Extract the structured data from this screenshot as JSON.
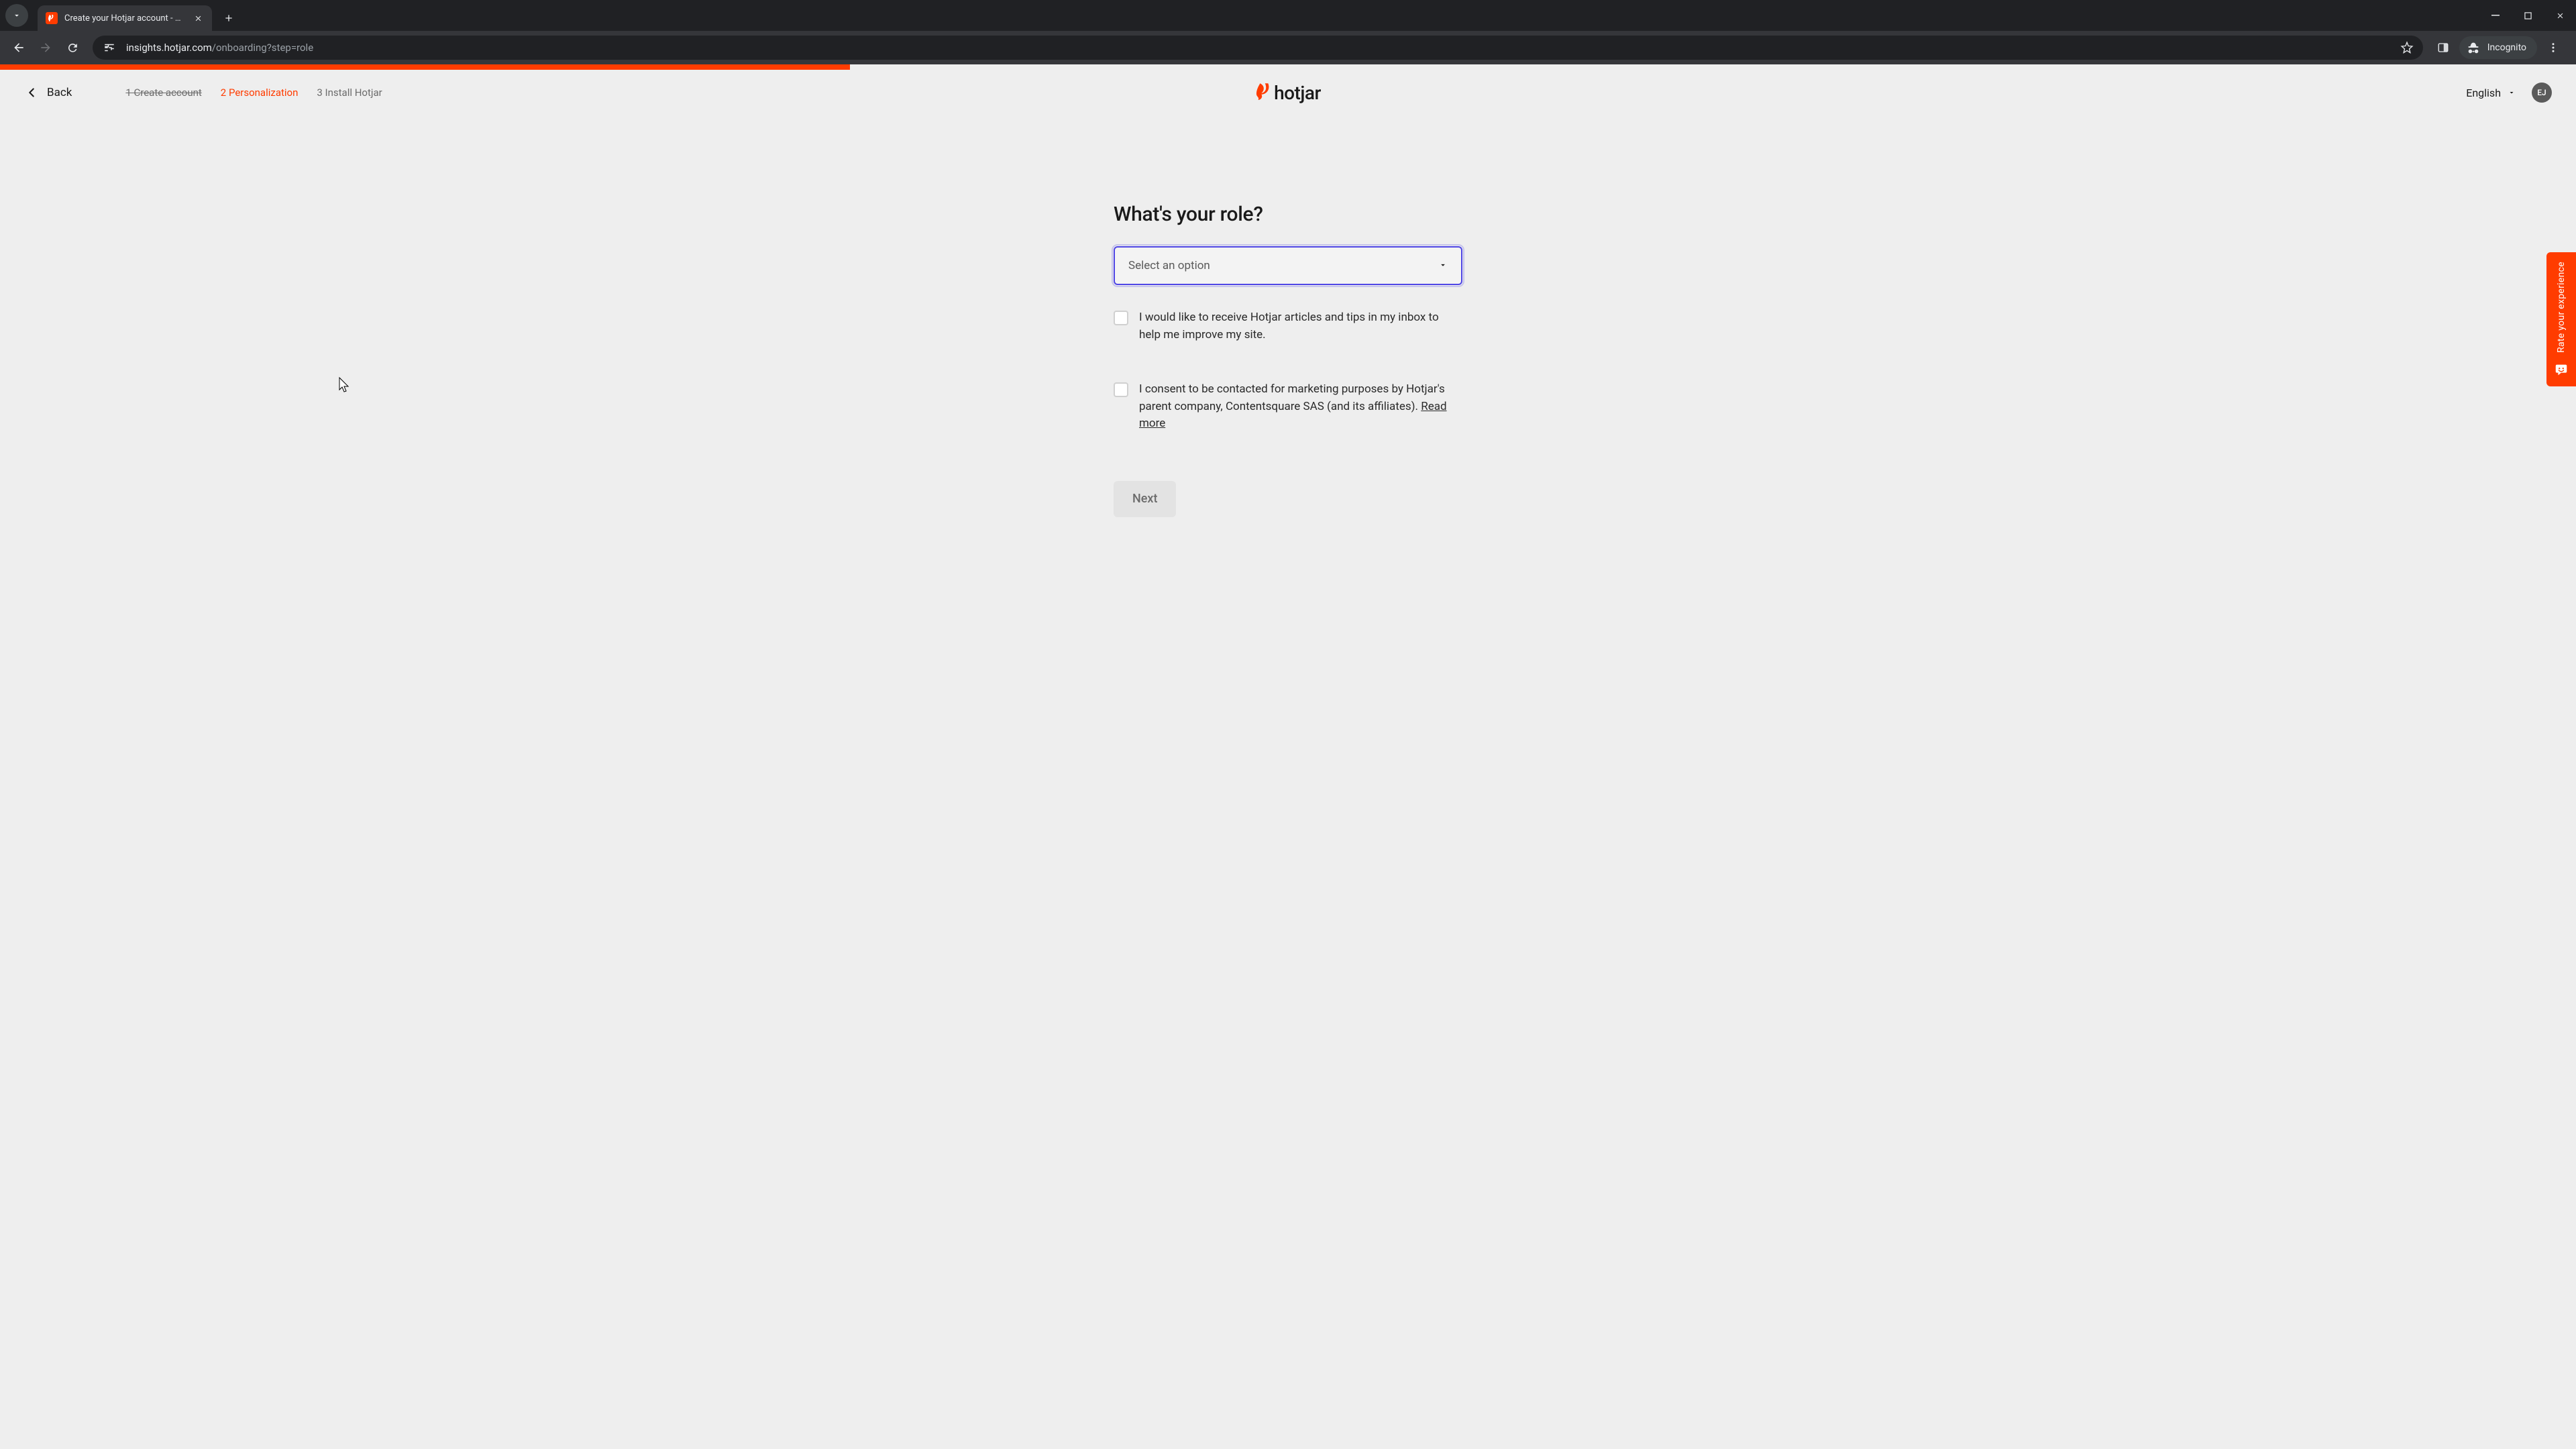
{
  "browser": {
    "tab_title": "Create your Hotjar account - Ho",
    "url_host": "insights.hotjar.com",
    "url_path": "/onboarding?step=role",
    "incognito_label": "Incognito"
  },
  "header": {
    "back_label": "Back",
    "steps": {
      "one": "1 Create account",
      "two": "2 Personalization",
      "three": "3 Install Hotjar"
    },
    "brand": "hotjar",
    "language": "English",
    "avatar_initials": "EJ"
  },
  "form": {
    "heading": "What's your role?",
    "select_placeholder": "Select an option",
    "checkbox_tips": "I would like to receive Hotjar articles and tips in my inbox to help me improve my site.",
    "checkbox_consent": "I consent to be contacted for marketing purposes by Hotjar's parent company, Contentsquare SAS (and its affiliates). ",
    "read_more": "Read more",
    "next_label": "Next"
  },
  "feedback": {
    "label": "Rate your experience"
  },
  "colors": {
    "brand": "#ff3c00",
    "focus": "#4f46e5",
    "page_bg": "#eeeeee"
  }
}
